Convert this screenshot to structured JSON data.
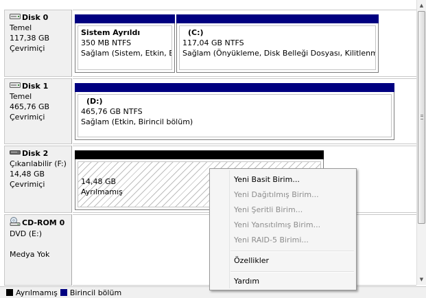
{
  "disks": [
    {
      "name": "Disk 0",
      "icon": "hard-disk-icon",
      "type": "Temel",
      "size": "117,38 GB",
      "status": "Çevrimiçi",
      "partitions": [
        {
          "title": "Sistem Ayrıldı",
          "size_fs": "350 MB NTFS",
          "status": "Sağlam (Sistem, Etkin, Bir"
        },
        {
          "title": "(C:)",
          "size_fs": "117,04 GB NTFS",
          "status": "Sağlam (Önyükleme, Disk Belleği Dosyası, Kilitlenme Bö"
        }
      ]
    },
    {
      "name": "Disk 1",
      "icon": "hard-disk-icon",
      "type": "Temel",
      "size": "465,76 GB",
      "status": "Çevrimiçi",
      "partitions": [
        {
          "title": "(D:)",
          "size_fs": "465,76 GB NTFS",
          "status": "Sağlam (Etkin, Birincil bölüm)"
        }
      ]
    },
    {
      "name": "Disk 2",
      "icon": "removable-disk-icon",
      "type": "Çıkarılabilir (F:)",
      "size": "14,48 GB",
      "status": "Çevrimiçi",
      "partitions": [
        {
          "size": "14,48 GB",
          "status": "Ayrılmamış"
        }
      ]
    },
    {
      "name": "CD-ROM 0",
      "icon": "cd-rom-icon",
      "type": "DVD (E:)",
      "status": "Medya Yok"
    }
  ],
  "legend": [
    {
      "label": "Ayrılmamış",
      "color": "#000000"
    },
    {
      "label": "Birincil bölüm",
      "color": "#000080"
    }
  ],
  "context_menu": {
    "items": [
      {
        "label": "Yeni Basit Birim...",
        "enabled": true
      },
      {
        "label": "Yeni Dağıtılmış Birim...",
        "enabled": false
      },
      {
        "label": "Yeni Şeritli Birim...",
        "enabled": false
      },
      {
        "label": "Yeni Yansıtılmış Birim...",
        "enabled": false
      },
      {
        "label": "Yeni RAID-5 Birimi...",
        "enabled": false
      },
      {
        "label": "Özellikler",
        "enabled": true
      },
      {
        "label": "Yardım",
        "enabled": true
      }
    ]
  },
  "colors": {
    "primary_partition": "#000080",
    "unallocated": "#000000",
    "disabled_text": "#8d8d8d"
  }
}
